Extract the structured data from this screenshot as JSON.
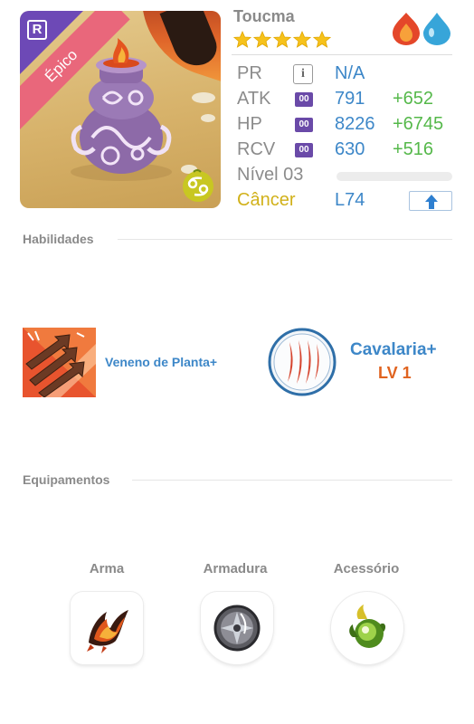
{
  "monster": {
    "name": "Toucma",
    "rarity_letter": "R",
    "rarity_label": "Épico",
    "stars": 5,
    "elements": [
      "fire-element-icon",
      "water-element-icon"
    ]
  },
  "stats": {
    "pr": {
      "label": "PR",
      "value": "N/A"
    },
    "atk": {
      "label": "ATK",
      "badge": "00",
      "value": "791",
      "bonus": "+652"
    },
    "hp": {
      "label": "HP",
      "badge": "00",
      "value": "8226",
      "bonus": "+6745"
    },
    "rcv": {
      "label": "RCV",
      "badge": "00",
      "value": "630",
      "bonus": "+516"
    },
    "level": {
      "label": "Nível 03",
      "progress": 0
    },
    "zodiac": {
      "label": "Câncer",
      "value": "L74"
    }
  },
  "skills": {
    "title": "Habilidades",
    "active_skill": {
      "name": "Veneno de Planta+"
    },
    "leader_skill": {
      "name": "Cavalaria+",
      "level": "LV 1"
    }
  },
  "equipment": {
    "title": "Equipamentos",
    "slots": [
      {
        "label": "Arma",
        "icon": "weapon-claw-icon"
      },
      {
        "label": "Armadura",
        "icon": "armor-shield-icon"
      },
      {
        "label": "Acessório",
        "icon": "accessory-orb-icon"
      }
    ]
  },
  "colors": {
    "accent_blue": "#3d87c8",
    "bonus_green": "#55b84a",
    "zodiac_yellow": "#d1b11a",
    "rarity_ribbon": "#e9677b",
    "leader_level_orange": "#e0631f"
  }
}
